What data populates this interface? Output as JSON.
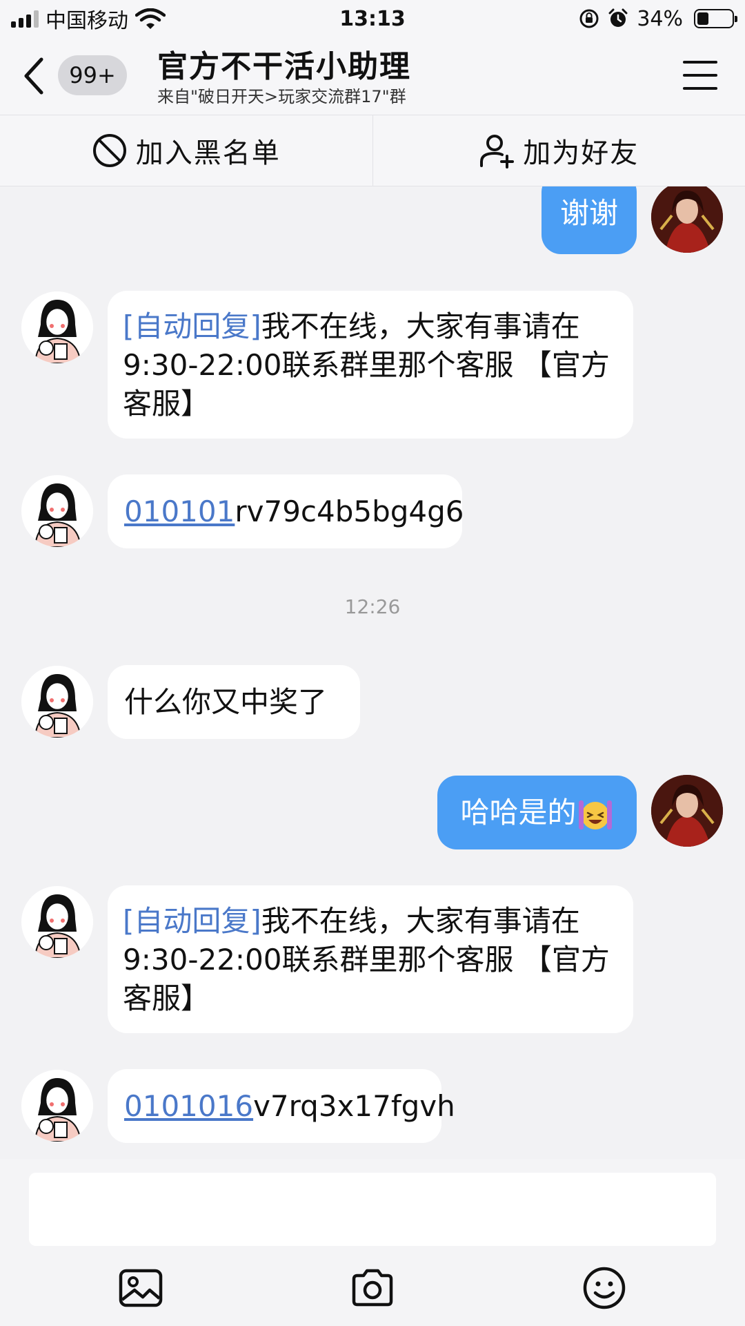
{
  "status_bar": {
    "carrier": "中国移动",
    "time": "13:13",
    "battery_percent": "34%",
    "battery_level": 0.34
  },
  "header": {
    "unread_badge": "99+",
    "title": "官方不干活小助理",
    "subtitle": "来自\"破日开天>玩家交流群17\"群"
  },
  "actions": {
    "block": "加入黑名单",
    "add_friend": "加为好友"
  },
  "messages": {
    "m1": "谢谢",
    "m2": {
      "tag": "[自动回复]",
      "text": "我不在线，大家有事请在9:30-22:00联系群里那个客服 【官方客服】"
    },
    "m3": {
      "link": "010101",
      "rest": "rv79c4b5bg4g6"
    },
    "timestamp": "12:26",
    "m4": "什么你又中奖了",
    "m5": "哈哈是的",
    "m6": {
      "tag": "[自动回复]",
      "text": "我不在线，大家有事请在9:30-22:00联系群里那个客服 【官方客服】"
    },
    "m7": {
      "link": "0101016",
      "rest": "v7rq3x17fgvh"
    }
  },
  "icons": {
    "back": "chevron-left-icon",
    "menu": "hamburger-menu-icon",
    "block": "block-icon",
    "add_friend": "add-user-icon",
    "image": "image-icon",
    "camera": "camera-icon",
    "emoji": "smiley-icon"
  },
  "colors": {
    "accent": "#4b9ef4",
    "link": "#4a78c9",
    "background": "#f2f2f4"
  }
}
